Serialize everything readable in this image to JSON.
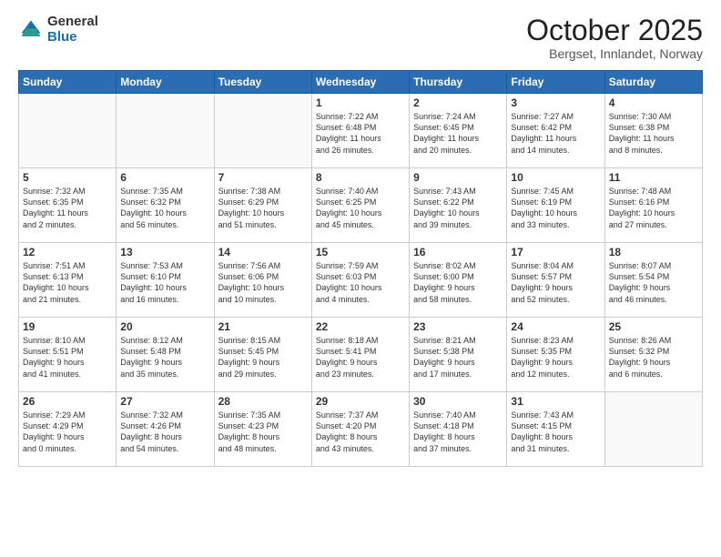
{
  "header": {
    "logo_general": "General",
    "logo_blue": "Blue",
    "month_title": "October 2025",
    "location": "Bergset, Innlandet, Norway"
  },
  "weekdays": [
    "Sunday",
    "Monday",
    "Tuesday",
    "Wednesday",
    "Thursday",
    "Friday",
    "Saturday"
  ],
  "weeks": [
    [
      {
        "day": "",
        "info": ""
      },
      {
        "day": "",
        "info": ""
      },
      {
        "day": "",
        "info": ""
      },
      {
        "day": "1",
        "info": "Sunrise: 7:22 AM\nSunset: 6:48 PM\nDaylight: 11 hours\nand 26 minutes."
      },
      {
        "day": "2",
        "info": "Sunrise: 7:24 AM\nSunset: 6:45 PM\nDaylight: 11 hours\nand 20 minutes."
      },
      {
        "day": "3",
        "info": "Sunrise: 7:27 AM\nSunset: 6:42 PM\nDaylight: 11 hours\nand 14 minutes."
      },
      {
        "day": "4",
        "info": "Sunrise: 7:30 AM\nSunset: 6:38 PM\nDaylight: 11 hours\nand 8 minutes."
      }
    ],
    [
      {
        "day": "5",
        "info": "Sunrise: 7:32 AM\nSunset: 6:35 PM\nDaylight: 11 hours\nand 2 minutes."
      },
      {
        "day": "6",
        "info": "Sunrise: 7:35 AM\nSunset: 6:32 PM\nDaylight: 10 hours\nand 56 minutes."
      },
      {
        "day": "7",
        "info": "Sunrise: 7:38 AM\nSunset: 6:29 PM\nDaylight: 10 hours\nand 51 minutes."
      },
      {
        "day": "8",
        "info": "Sunrise: 7:40 AM\nSunset: 6:25 PM\nDaylight: 10 hours\nand 45 minutes."
      },
      {
        "day": "9",
        "info": "Sunrise: 7:43 AM\nSunset: 6:22 PM\nDaylight: 10 hours\nand 39 minutes."
      },
      {
        "day": "10",
        "info": "Sunrise: 7:45 AM\nSunset: 6:19 PM\nDaylight: 10 hours\nand 33 minutes."
      },
      {
        "day": "11",
        "info": "Sunrise: 7:48 AM\nSunset: 6:16 PM\nDaylight: 10 hours\nand 27 minutes."
      }
    ],
    [
      {
        "day": "12",
        "info": "Sunrise: 7:51 AM\nSunset: 6:13 PM\nDaylight: 10 hours\nand 21 minutes."
      },
      {
        "day": "13",
        "info": "Sunrise: 7:53 AM\nSunset: 6:10 PM\nDaylight: 10 hours\nand 16 minutes."
      },
      {
        "day": "14",
        "info": "Sunrise: 7:56 AM\nSunset: 6:06 PM\nDaylight: 10 hours\nand 10 minutes."
      },
      {
        "day": "15",
        "info": "Sunrise: 7:59 AM\nSunset: 6:03 PM\nDaylight: 10 hours\nand 4 minutes."
      },
      {
        "day": "16",
        "info": "Sunrise: 8:02 AM\nSunset: 6:00 PM\nDaylight: 9 hours\nand 58 minutes."
      },
      {
        "day": "17",
        "info": "Sunrise: 8:04 AM\nSunset: 5:57 PM\nDaylight: 9 hours\nand 52 minutes."
      },
      {
        "day": "18",
        "info": "Sunrise: 8:07 AM\nSunset: 5:54 PM\nDaylight: 9 hours\nand 46 minutes."
      }
    ],
    [
      {
        "day": "19",
        "info": "Sunrise: 8:10 AM\nSunset: 5:51 PM\nDaylight: 9 hours\nand 41 minutes."
      },
      {
        "day": "20",
        "info": "Sunrise: 8:12 AM\nSunset: 5:48 PM\nDaylight: 9 hours\nand 35 minutes."
      },
      {
        "day": "21",
        "info": "Sunrise: 8:15 AM\nSunset: 5:45 PM\nDaylight: 9 hours\nand 29 minutes."
      },
      {
        "day": "22",
        "info": "Sunrise: 8:18 AM\nSunset: 5:41 PM\nDaylight: 9 hours\nand 23 minutes."
      },
      {
        "day": "23",
        "info": "Sunrise: 8:21 AM\nSunset: 5:38 PM\nDaylight: 9 hours\nand 17 minutes."
      },
      {
        "day": "24",
        "info": "Sunrise: 8:23 AM\nSunset: 5:35 PM\nDaylight: 9 hours\nand 12 minutes."
      },
      {
        "day": "25",
        "info": "Sunrise: 8:26 AM\nSunset: 5:32 PM\nDaylight: 9 hours\nand 6 minutes."
      }
    ],
    [
      {
        "day": "26",
        "info": "Sunrise: 7:29 AM\nSunset: 4:29 PM\nDaylight: 9 hours\nand 0 minutes."
      },
      {
        "day": "27",
        "info": "Sunrise: 7:32 AM\nSunset: 4:26 PM\nDaylight: 8 hours\nand 54 minutes."
      },
      {
        "day": "28",
        "info": "Sunrise: 7:35 AM\nSunset: 4:23 PM\nDaylight: 8 hours\nand 48 minutes."
      },
      {
        "day": "29",
        "info": "Sunrise: 7:37 AM\nSunset: 4:20 PM\nDaylight: 8 hours\nand 43 minutes."
      },
      {
        "day": "30",
        "info": "Sunrise: 7:40 AM\nSunset: 4:18 PM\nDaylight: 8 hours\nand 37 minutes."
      },
      {
        "day": "31",
        "info": "Sunrise: 7:43 AM\nSunset: 4:15 PM\nDaylight: 8 hours\nand 31 minutes."
      },
      {
        "day": "",
        "info": ""
      }
    ]
  ]
}
